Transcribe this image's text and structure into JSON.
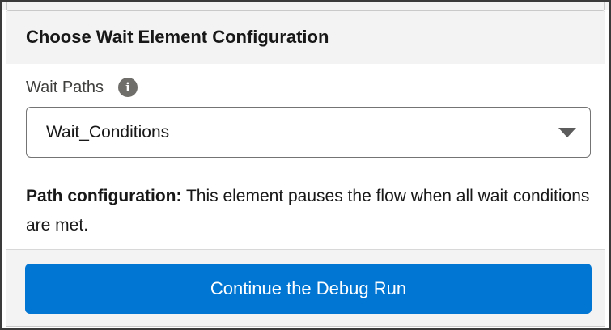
{
  "dialog": {
    "title": "Choose Wait Element Configuration",
    "field_label": "Wait Paths",
    "info_icon": "i",
    "select_value": "Wait_Conditions",
    "description_label": "Path configuration:",
    "description_text": " This element pauses the flow when all wait conditions are met.",
    "primary_button_label": "Continue the Debug Run"
  },
  "colors": {
    "primary_button": "#0176d3",
    "header_background": "#f3f3f3",
    "info_icon": "#706e6b"
  }
}
